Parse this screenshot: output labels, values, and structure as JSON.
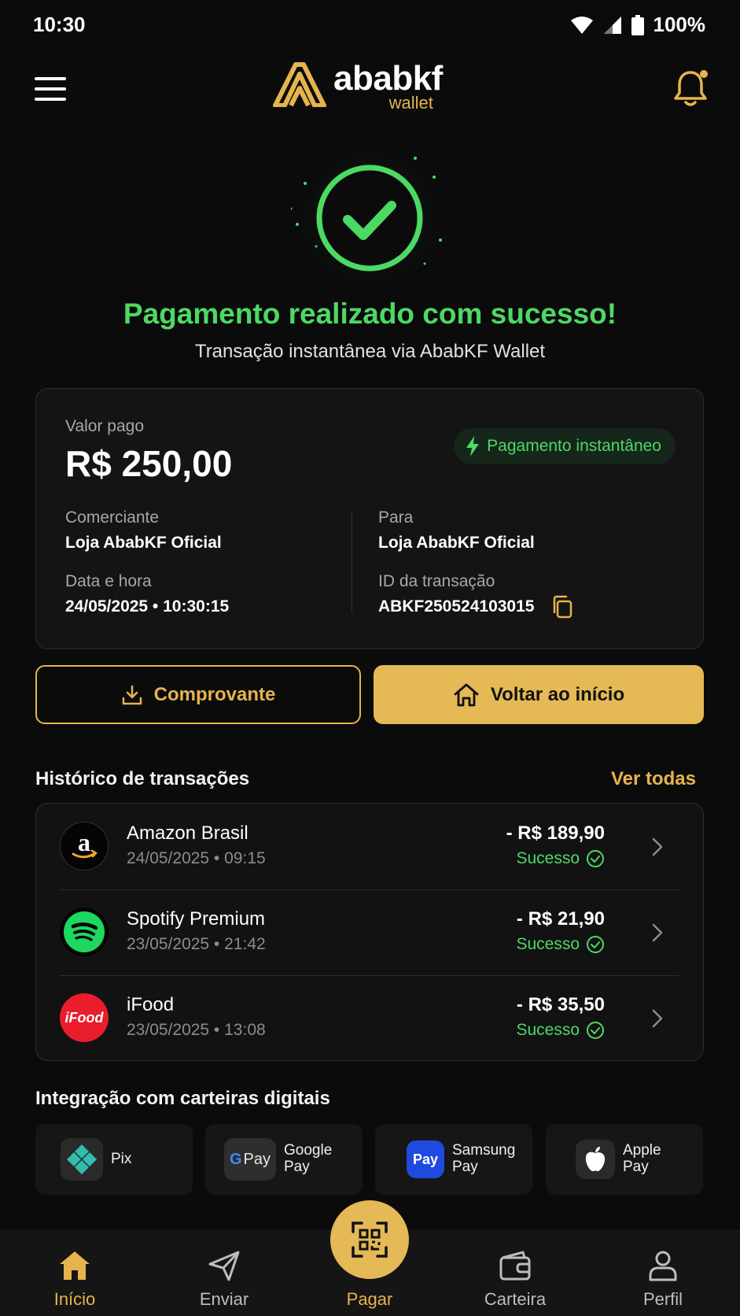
{
  "status_bar": {
    "time": "10:30",
    "battery": "100%"
  },
  "header": {
    "brand_name": "ababkf",
    "brand_sub": "wallet"
  },
  "success": {
    "title": "Pagamento realizado com sucesso!",
    "subtitle": "Transação instantânea via AbabKF Wallet"
  },
  "payment": {
    "amount_label": "Valor pago",
    "amount": "R$ 250,00",
    "badge": "Pagamento instantâneo",
    "merchant_label": "Comerciante",
    "merchant": "Loja AbabKF Oficial",
    "to_label": "Para",
    "to": "Loja AbabKF Oficial",
    "datetime_label": "Data e hora",
    "datetime": "24/05/2025 • 10:30:15",
    "txid_label": "ID da transação",
    "txid": "ABKF250524103015"
  },
  "actions": {
    "receipt": "Comprovante",
    "home": "Voltar ao início"
  },
  "history": {
    "title": "Histórico de transações",
    "see_all": "Ver todas",
    "items": [
      {
        "name": "Amazon Brasil",
        "date": "24/05/2025 • 09:15",
        "amount": "- R$ 189,90",
        "status": "Sucesso",
        "logo": "amazon-logo"
      },
      {
        "name": "Spotify Premium",
        "date": "23/05/2025 • 21:42",
        "amount": "- R$ 21,90",
        "status": "Sucesso",
        "logo": "spotify-logo"
      },
      {
        "name": "iFood",
        "date": "23/05/2025 • 13:08",
        "amount": "- R$ 35,50",
        "status": "Sucesso",
        "logo": "ifood-logo",
        "logo_text": "iFood"
      }
    ]
  },
  "wallets": {
    "title": "Integração com carteiras digitais",
    "items": [
      {
        "label": "Pix"
      },
      {
        "label_line1": "Google",
        "label_line2": "Pay",
        "icon_text": "Pay"
      },
      {
        "label_line1": "Samsung",
        "label_line2": "Pay",
        "icon_text": "Pay"
      },
      {
        "label_line1": "Apple",
        "label_line2": "Pay"
      }
    ]
  },
  "nav": {
    "home": "Início",
    "send": "Enviar",
    "pay": "Pagar",
    "wallet": "Carteira",
    "profile": "Perfil"
  },
  "colors": {
    "accent": "#e6b44c",
    "success": "#4cd964",
    "background": "#0b0b0b"
  }
}
